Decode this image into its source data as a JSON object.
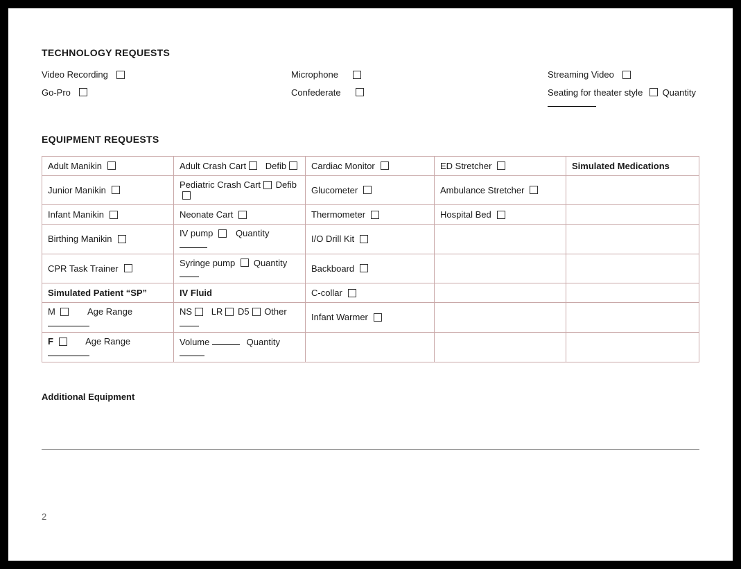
{
  "headings": {
    "tech": "TECHNOLOGY REQUESTS",
    "equip": "EQUIPMENT REQUESTS",
    "additional": "Additional Equipment"
  },
  "tech": {
    "video_recording": "Video Recording",
    "microphone": "Microphone",
    "streaming": "Streaming  Video",
    "gopro": "Go-Pro",
    "confederate": "Confederate",
    "seating": "Seating for theater style",
    "quantity": "Quantity"
  },
  "table": {
    "r1": {
      "a": "Adult Manikin",
      "b1": "Adult Crash Cart",
      "b2": "Defib",
      "c": "Cardiac Monitor",
      "d": "ED Stretcher",
      "e": "Simulated Medications"
    },
    "r2": {
      "a": "Junior Manikin",
      "b1": "Pediatric Crash Cart",
      "b2": "Defib",
      "c": "Glucometer",
      "d": "Ambulance Stretcher"
    },
    "r3": {
      "a": "Infant Manikin",
      "b": "Neonate Cart",
      "c": "Thermometer",
      "d": "Hospital Bed"
    },
    "r4": {
      "a": "Birthing Manikin",
      "b": "IV pump",
      "bq": "Quantity",
      "c": "I/O Drill Kit"
    },
    "r5": {
      "a": "CPR Task Trainer",
      "b": "Syringe pump",
      "bq": "Quantity",
      "c": "Backboard"
    },
    "r6": {
      "a": "Simulated Patient  “SP”",
      "b": "IV Fluid",
      "c": "C-collar"
    },
    "r7": {
      "a1": "M",
      "a2": "Age Range",
      "b1": "NS",
      "b2": "LR",
      "b3": "D5",
      "b4": "Other",
      "c": "Infant Warmer"
    },
    "r8": {
      "a1": "F",
      "a2": "Age Range",
      "b1": "Volume",
      "b2": "Quantity"
    }
  },
  "page": "2"
}
